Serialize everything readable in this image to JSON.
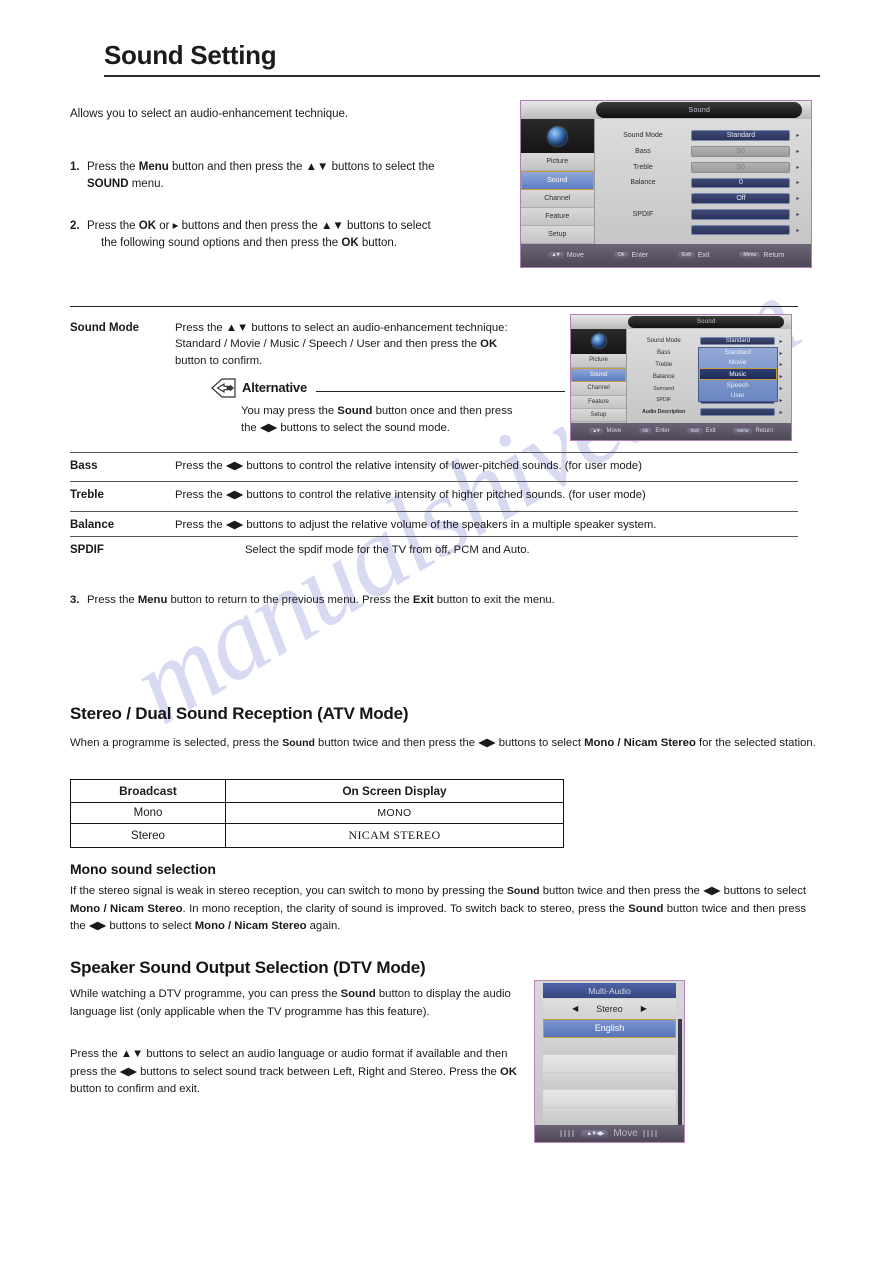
{
  "document": {
    "title": "Sound Setting",
    "watermark": "manualshive.com"
  },
  "intro": {
    "text": "Allows you to select an audio-enhancement technique."
  },
  "steps": [
    {
      "num": "1.",
      "line1_a": "Press the ",
      "line1_b": "Menu",
      "line1_c": " button and then press the ▲▼ buttons to select the ",
      "line2_b": "SOUND",
      "line2_c": " menu."
    },
    {
      "num": "2.",
      "line1_a": "Press the ",
      "line1_b": "OK",
      "line1_c": " or ▸ buttons and  then  press  the  ▲▼  buttons  to  select",
      "line2_a": "the  following sound  options and then press  the  ",
      "line2_b": "OK",
      "line2_c": "  button."
    },
    {
      "num": "3.",
      "a": "Press the ",
      "b": "Menu",
      "c": " button to return to the previous menu. Press the ",
      "d": "Exit",
      "e": "  button to exit the menu."
    }
  ],
  "properties": [
    {
      "label": "Sound Mode",
      "body_a": "Press the ▲▼ buttons to select an audio-enhancement technique:",
      "body_b": "Standard / Movie / Music / Speech / User and then press the ",
      "body_c": "OK",
      "body_d": "button to confirm.",
      "alternative": {
        "heading": "Alternative",
        "text_a": "You may press the ",
        "text_b": "Sound",
        "text_c": " button once and then press",
        "text_d": "the ◀▶ buttons to select the sound mode."
      }
    },
    {
      "label": "Bass",
      "body": "Press the ◀▶ buttons to control the relative intensity of lower-pitched sounds. (for user mode)"
    },
    {
      "label": "Treble",
      "body": "Press the ◀▶ buttons to control the relative intensity of higher pitched sounds. (for user mode)"
    },
    {
      "label": "Balance",
      "body": "Press the ◀▶ buttons to adjust the relative volume of the speakers in a multiple speaker system."
    },
    {
      "label": "SPDIF",
      "body": "Select the spdif mode for the TV from off, PCM and Auto."
    }
  ],
  "sections": {
    "stereo_dual": {
      "heading": "Stereo / Dual Sound Reception (ATV Mode)",
      "para_a": "When a programme is selected, press the ",
      "para_b": "Sound",
      "para_c": " button twice and then press the",
      "para_d": " ◀▶ buttons to select ",
      "para_e": "Mono / Nicam Stereo",
      "para_f": " for the selected station."
    },
    "mono_selection": {
      "heading": "Mono sound selection",
      "p1": "If the stereo signal is weak in stereo reception, you can switch to mono by pressing the ",
      "p1_b": "Sound",
      "p1_c": " button twice and then press the ◀▶ buttons to select ",
      "p1_d": "Mono / Nicam Stereo",
      "p1_e": ". In mono reception, the clarity of sound is improved. To switch back to stereo, press the ",
      "p1_f": "Sound",
      "p1_g": " button twice and then press the ◀▶ buttons to select ",
      "p1_h": "Mono / Nicam Stereo",
      "p1_i": " again."
    },
    "speaker_output": {
      "heading": "Speaker Sound Output Selection (DTV Mode)",
      "p1_a": "While watching a DTV programme, you can press the ",
      "p1_b": "Sound",
      "p1_c": " button to display the audio language list (only applicable when the TV programme has this feature).",
      "p2_a": "Press the ▲▼ buttons to select an audio language or audio format if available and then press the ◀▶ buttons to select sound track between Left, Right and Stereo. Press the ",
      "p2_b": "OK",
      "p2_c": " button to confirm and exit."
    }
  },
  "broadcast_table": {
    "headers": [
      "Broadcast",
      "On Screen Display"
    ],
    "rows": [
      {
        "broadcast": "Mono",
        "osd": "MONO"
      },
      {
        "broadcast": "Stereo",
        "osd": "NICAM STEREO"
      }
    ]
  },
  "osd_main": {
    "title": "Sound",
    "sidebar": [
      "Picture",
      "Sound",
      "Channel",
      "Feature",
      "Setup"
    ],
    "active_sidebar": "Sound",
    "rows": [
      {
        "label": "Sound Mode",
        "value": "Standard",
        "dim": false
      },
      {
        "label": "Bass",
        "value": "50",
        "dim": true
      },
      {
        "label": "Treble",
        "value": "50",
        "dim": true
      },
      {
        "label": "Balance",
        "value": "0",
        "dim": false
      },
      {
        "label": "",
        "value": "Off",
        "dim": false
      },
      {
        "label": "SPDIF",
        "value": "",
        "dim": false
      },
      {
        "label": "",
        "value": "",
        "dim": false
      }
    ],
    "footer": [
      {
        "key": "▲▼",
        "label": "Move"
      },
      {
        "key": "Ok",
        "label": "Enter"
      },
      {
        "key": "Exit",
        "label": "Exit"
      },
      {
        "key": "Menu",
        "label": "Return"
      }
    ]
  },
  "osd_mode": {
    "title": "Sound",
    "sidebar": [
      "Picture",
      "Sound",
      "Channel",
      "Feature",
      "Setup"
    ],
    "active_sidebar": "Sound",
    "rows": [
      {
        "label": "Sound Mode",
        "value": "Standard"
      },
      {
        "label": "Bass",
        "value": ""
      },
      {
        "label": "Treble",
        "value": ""
      },
      {
        "label": "Balance",
        "value": ""
      },
      {
        "label": "Surround",
        "value": ""
      },
      {
        "label": "SPDIF",
        "value": ""
      },
      {
        "label": "Audio Description",
        "value": ""
      }
    ],
    "dropdown": {
      "options": [
        "Standard",
        "Movie",
        "Music",
        "Speech",
        "User"
      ],
      "selected": "Music"
    },
    "footer": [
      {
        "key": "▲▼",
        "label": "Move"
      },
      {
        "key": "Ok",
        "label": "Enter"
      },
      {
        "key": "Exit",
        "label": "Exit"
      },
      {
        "key": "Menu",
        "label": "Return"
      }
    ]
  },
  "multi_audio": {
    "title": "Multi-Audio",
    "track": "Stereo",
    "left_arrow": "◀",
    "right_arrow": "▶",
    "items": [
      "English",
      "",
      "",
      "",
      "",
      ""
    ],
    "selected": "English",
    "footer": {
      "key": "▲▼◀▶",
      "label": "Move"
    }
  }
}
